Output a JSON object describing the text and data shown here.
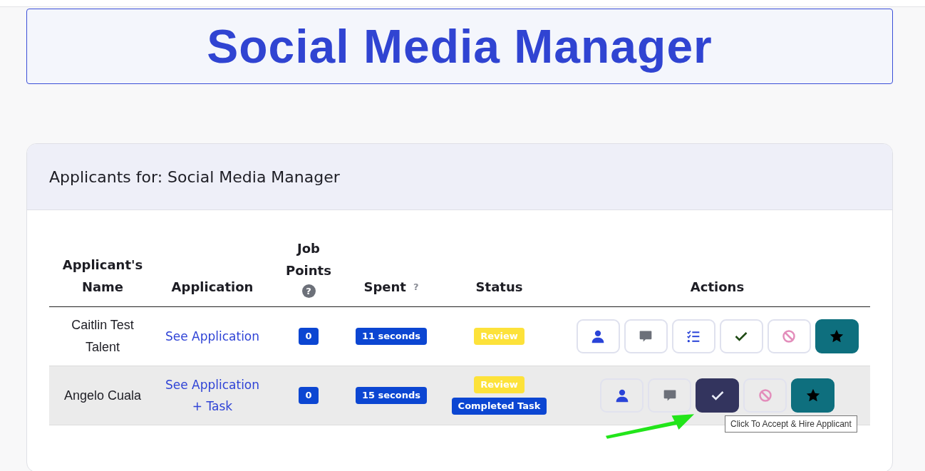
{
  "page_title": "Social Media Manager",
  "panel": {
    "title": "Applicants for: Social Media Manager",
    "columns": [
      {
        "label": "Applicant's Name"
      },
      {
        "label": "Application"
      },
      {
        "label": "Job Points",
        "help": "?",
        "kind": "circle"
      },
      {
        "label": "Spent",
        "help": "?",
        "kind": "plain"
      },
      {
        "label": "Status"
      },
      {
        "label": "Actions"
      }
    ],
    "rows": [
      {
        "name": "Caitlin Test Talent",
        "application": [
          "See Application"
        ],
        "job_points": "0",
        "spent": "11 seconds",
        "highlighted": false,
        "status": [
          {
            "label": "Review",
            "kind": "review"
          }
        ],
        "actions": [
          {
            "kind": "profile",
            "highlighted": false
          },
          {
            "kind": "message",
            "highlighted": false
          },
          {
            "kind": "tasks",
            "highlighted": false
          },
          {
            "kind": "accept",
            "highlighted": false
          },
          {
            "kind": "reject",
            "highlighted": false
          },
          {
            "kind": "star",
            "highlighted": false
          }
        ]
      },
      {
        "name": "Angelo Cuala",
        "application": [
          "See Application",
          "+ Task"
        ],
        "job_points": "0",
        "spent": "15 seconds",
        "highlighted": true,
        "status": [
          {
            "label": "Review",
            "kind": "review"
          },
          {
            "label": "Completed Task",
            "kind": "completed"
          }
        ],
        "actions": [
          {
            "kind": "profile",
            "highlighted": false
          },
          {
            "kind": "message",
            "highlighted": false
          },
          {
            "kind": "accept",
            "highlighted": true,
            "tooltip": "Click To Accept & Hire Applicant"
          },
          {
            "kind": "reject",
            "highlighted": false
          },
          {
            "kind": "star",
            "highlighted": false
          }
        ]
      }
    ]
  }
}
